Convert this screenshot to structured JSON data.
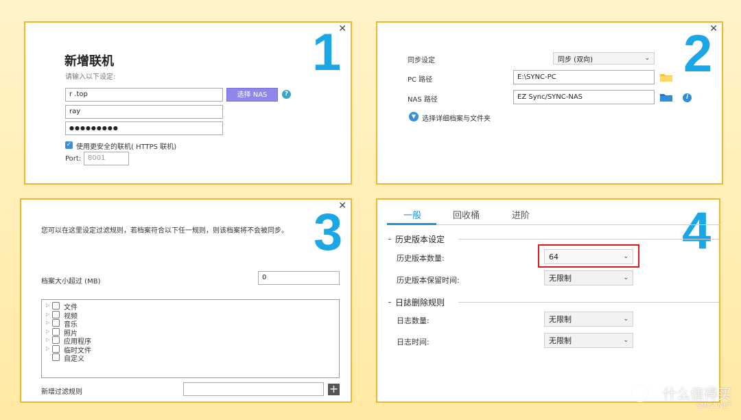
{
  "panel1": {
    "number": "1",
    "title": "新增联机",
    "subtitle": "请输入以下设定:",
    "host_value": "r          .top",
    "user_value": "ray",
    "password_value": "●●●●●●●●●",
    "select_nas_label": "选择 NAS",
    "help_glyph": "?",
    "https_label": "使用更安全的联机( HTTPS 联机)",
    "port_label": "Port:",
    "port_placeholder": "8001"
  },
  "panel2": {
    "number": "2",
    "sync_label": "同步设定",
    "sync_value": "同步 (双向)",
    "pc_label": "PC 路径",
    "pc_value": "E:\\SYNC-PC",
    "nas_label": "NAS 路径",
    "nas_value": "EZ Sync/SYNC-NAS",
    "info_glyph": "i",
    "advanced_label": "选择详细档案与文件夹"
  },
  "panel3": {
    "number": "3",
    "description": "您可以在这里设定过滤规则，若档案符合以下任一规则，则该档案将不会被同步。",
    "size_label": "档案大小超过 (MB)",
    "size_value": "0",
    "tree_items": [
      "文件",
      "视频",
      "音乐",
      "照片",
      "应用程序",
      "临时文件",
      "自定义"
    ],
    "add_rule_label": "新增过滤规则",
    "add_glyph": "+"
  },
  "panel4": {
    "number": "4",
    "tabs": [
      "一般",
      "回收桶",
      "进阶"
    ],
    "history_title": "历史版本设定",
    "history_count_label": "历史版本数量:",
    "history_count_value": "64",
    "history_time_label": "历史版本保留时间:",
    "history_time_value": "无限制",
    "log_title": "日誌删除规则",
    "log_count_label": "日志数量:",
    "log_count_value": "无限制",
    "log_time_label": "日志时间:",
    "log_time_value": "无限制"
  },
  "close_glyph": "✕",
  "watermark": {
    "brand": "什么值得买",
    "site": "SMYZ.NET"
  },
  "colors": {
    "accent": "#1ba7e5",
    "panel_border": "#f2b52f",
    "highlight": "#e0171f"
  }
}
